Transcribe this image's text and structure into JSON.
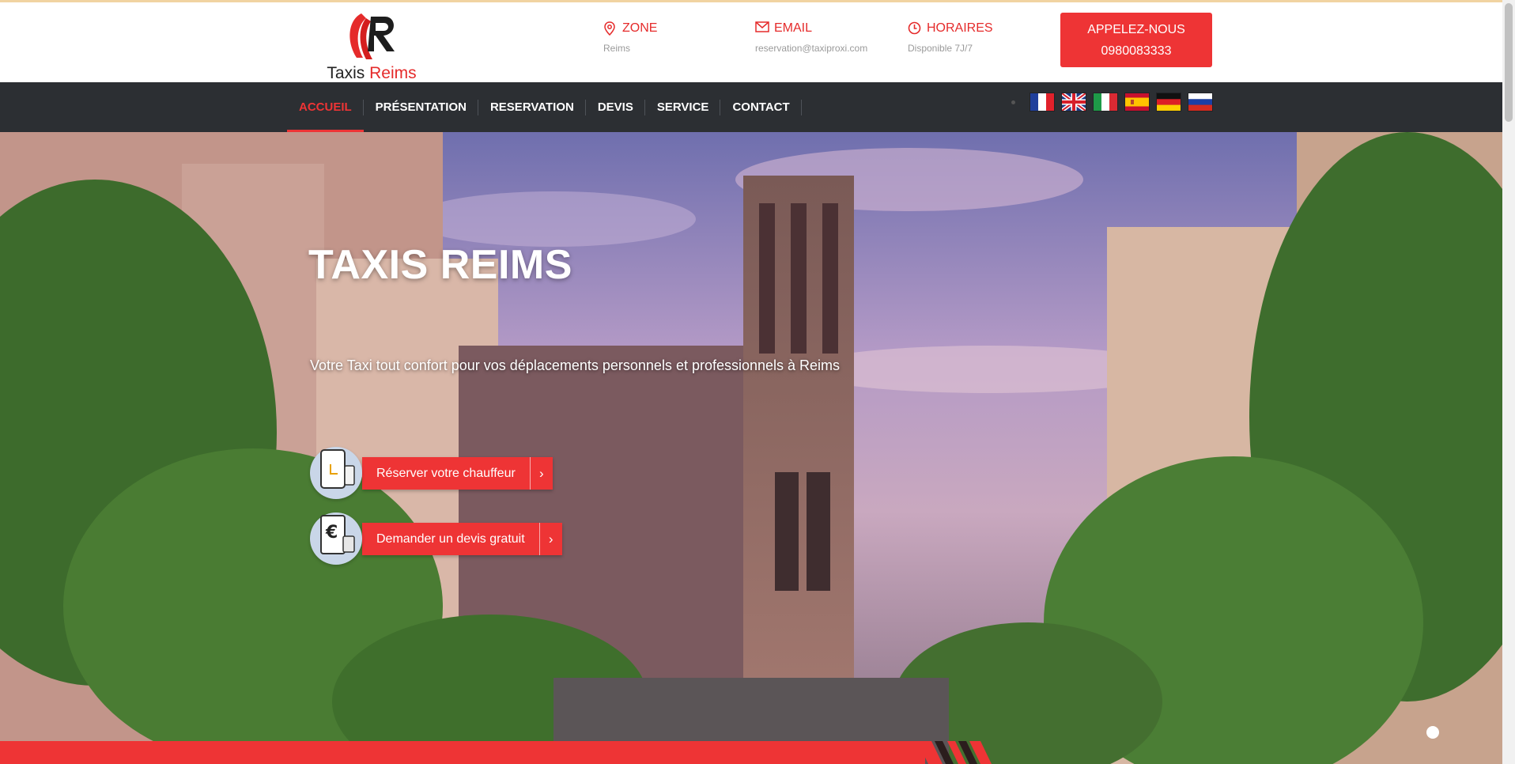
{
  "brand": {
    "name_prefix": "Taxis",
    "name_accent": "Reims",
    "accent_color": "#ee3435"
  },
  "header": {
    "zone": {
      "icon": "location-pin-icon",
      "title": "ZONE",
      "value": "Reims"
    },
    "email": {
      "icon": "envelope-icon",
      "title": "EMAIL",
      "value": "reservation@taxiproxi.com"
    },
    "hours": {
      "icon": "clock-icon",
      "title": "HORAIRES",
      "value": "Disponible 7J/7"
    },
    "call": {
      "label": "APPELEZ-NOUS",
      "phone": "0980083333"
    }
  },
  "nav": {
    "items": [
      {
        "label": "ACCUEIL",
        "active": true
      },
      {
        "label": "PRÉSENTATION"
      },
      {
        "label": "RESERVATION"
      },
      {
        "label": "DEVIS"
      },
      {
        "label": "SERVICE"
      },
      {
        "label": "CONTACT"
      }
    ],
    "languages": [
      "french-flag-icon",
      "uk-flag-icon",
      "italian-flag-icon",
      "spanish-flag-icon",
      "german-flag-icon",
      "russian-flag-icon"
    ]
  },
  "hero": {
    "title": "TAXIS REIMS",
    "subtitle": "Votre Taxi tout confort pour vos déplacements personnels et professionnels à Reims",
    "cta_book": {
      "label": "Réserver votre chauffeur",
      "icon": "phone-clock-icon"
    },
    "cta_quote": {
      "label": "Demander un devis gratuit",
      "icon": "euro-tablet-icon"
    },
    "arrow": "›"
  },
  "colors": {
    "nav_bg": "#2c2f33",
    "header_text": "#e52b2b",
    "muted_text": "#9a9a9a"
  }
}
